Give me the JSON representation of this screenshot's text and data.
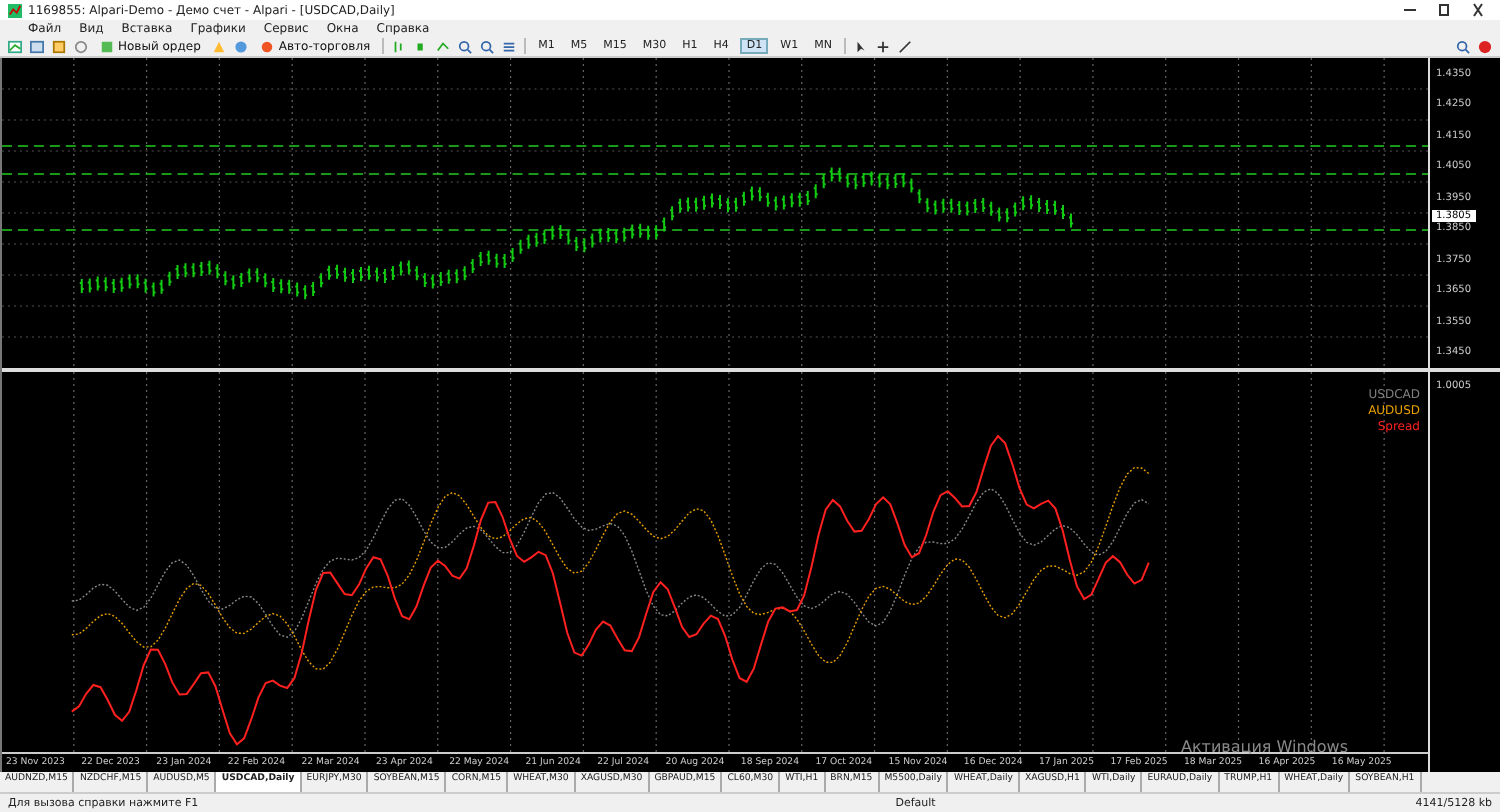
{
  "window": {
    "title": "1169855: Alpari-Demo - Демо счет - Alpari - [USDCAD,Daily]"
  },
  "menu": [
    "Файл",
    "Вид",
    "Вставка",
    "Графики",
    "Сервис",
    "Окна",
    "Справка"
  ],
  "toolbar": {
    "new_order": "Новый ордер",
    "auto_trading": "Авто-торговля"
  },
  "timeframes": [
    {
      "label": "M1",
      "selected": false
    },
    {
      "label": "M5",
      "selected": false
    },
    {
      "label": "M15",
      "selected": false
    },
    {
      "label": "M30",
      "selected": false
    },
    {
      "label": "H1",
      "selected": false
    },
    {
      "label": "H4",
      "selected": false
    },
    {
      "label": "D1",
      "selected": true
    },
    {
      "label": "W1",
      "selected": false
    },
    {
      "label": "MN",
      "selected": false
    }
  ],
  "price_axis": [
    "1.4350",
    "1.4250",
    "1.4150",
    "1.4050",
    "1.3950",
    "1.3850",
    "1.3750",
    "1.3650",
    "1.3550",
    "1.3450"
  ],
  "current_price": "1.3805",
  "indicator_axis": "1.0005",
  "legend": [
    {
      "label": "USDCAD",
      "color": "#808080"
    },
    {
      "label": "AUDUSD",
      "color": "#e8a000"
    },
    {
      "label": "Spread",
      "color": "#ff2020"
    }
  ],
  "dates": [
    "23 Nov 2023",
    "22 Dec 2023",
    "23 Jan 2024",
    "22 Feb 2024",
    "22 Mar 2024",
    "23 Apr 2024",
    "22 May 2024",
    "21 Jun 2024",
    "22 Jul 2024",
    "20 Aug 2024",
    "18 Sep 2024",
    "17 Oct 2024",
    "15 Nov 2024",
    "16 Dec 2024",
    "17 Jan 2025",
    "17 Feb 2025",
    "18 Mar 2025",
    "16 Apr 2025",
    "16 May 2025"
  ],
  "os_notice": "Активация Windows",
  "tabs": [
    {
      "label": "AUDNZD,M15",
      "selected": false
    },
    {
      "label": "NZDCHF,M15",
      "selected": false
    },
    {
      "label": "AUDUSD,M5",
      "selected": false
    },
    {
      "label": "USDCAD,Daily",
      "selected": true
    },
    {
      "label": "EURJPY,M30",
      "selected": false
    },
    {
      "label": "SOYBEAN,M15",
      "selected": false
    },
    {
      "label": "CORN,M15",
      "selected": false
    },
    {
      "label": "WHEAT,M30",
      "selected": false
    },
    {
      "label": "XAGUSD,M30",
      "selected": false
    },
    {
      "label": "GBPAUD,M15",
      "selected": false
    },
    {
      "label": "CL60,M30",
      "selected": false
    },
    {
      "label": "WTI,H1",
      "selected": false
    },
    {
      "label": "BRN,M15",
      "selected": false
    },
    {
      "label": "M5500,Daily",
      "selected": false
    },
    {
      "label": "WHEAT,Daily",
      "selected": false
    },
    {
      "label": "XAGUSD,H1",
      "selected": false
    },
    {
      "label": "WTI,Daily",
      "selected": false
    },
    {
      "label": "EURAUD,Daily",
      "selected": false
    },
    {
      "label": "TRUMP,H1",
      "selected": false
    },
    {
      "label": "WHEAT,Daily",
      "selected": false
    },
    {
      "label": "SOYBEAN,H1",
      "selected": false
    }
  ],
  "status_bar": {
    "hint": "Для вызова справки нажмите F1",
    "profile": "Default",
    "traffic": "4141/5128 kb"
  }
}
